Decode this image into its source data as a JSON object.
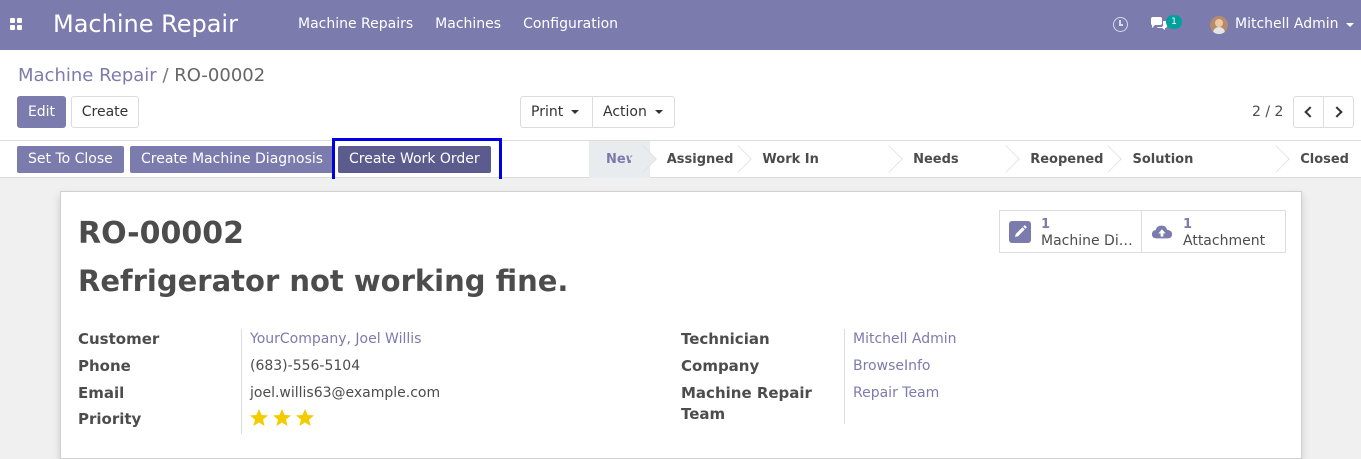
{
  "navbar": {
    "app_title": "Machine Repair",
    "menu": [
      "Machine Repairs",
      "Machines",
      "Configuration"
    ],
    "chat_count": "1",
    "user_name": "Mitchell Admin"
  },
  "breadcrumb": {
    "parent": "Machine Repair",
    "separator": "/",
    "current": "RO-00002"
  },
  "toolbar": {
    "edit_label": "Edit",
    "create_label": "Create",
    "print_label": "Print",
    "action_label": "Action",
    "pager": "2 / 2"
  },
  "header_buttons": {
    "set_to_close": "Set To Close",
    "create_diagnosis": "Create Machine Diagnosis",
    "create_work_order": "Create Work Order"
  },
  "stages": [
    {
      "label": "New",
      "current": true
    },
    {
      "label": "Assigned",
      "current": false
    },
    {
      "label": "Work In Progress",
      "current": false
    },
    {
      "label": "Needs Reply",
      "current": false
    },
    {
      "label": "Reopened",
      "current": false
    },
    {
      "label": "Solution Suggested",
      "current": false
    },
    {
      "label": "Closed",
      "current": false
    }
  ],
  "smart_buttons": {
    "diagnosis": {
      "count": "1",
      "label": "Machine Diagnosis"
    },
    "attachment": {
      "count": "1",
      "label": "Attachment"
    }
  },
  "record": {
    "reference": "RO-00002",
    "title": "Refrigerator not working fine."
  },
  "fields_left": {
    "customer_label": "Customer",
    "customer_value": "YourCompany, Joel Willis",
    "phone_label": "Phone",
    "phone_value": "(683)-556-5104",
    "email_label": "Email",
    "email_value": "joel.willis63@example.com",
    "priority_label": "Priority",
    "priority_stars": 3
  },
  "fields_right": {
    "technician_label": "Technician",
    "technician_value": "Mitchell Admin",
    "company_label": "Company",
    "company_value": "BrowseInfo",
    "team_label_1": "Machine Repair",
    "team_label_2": "Team",
    "team_value": "Repair Team"
  },
  "colors": {
    "brand": "#7c7bad",
    "star": "#f3cc00",
    "highlight": "#0000e6"
  }
}
